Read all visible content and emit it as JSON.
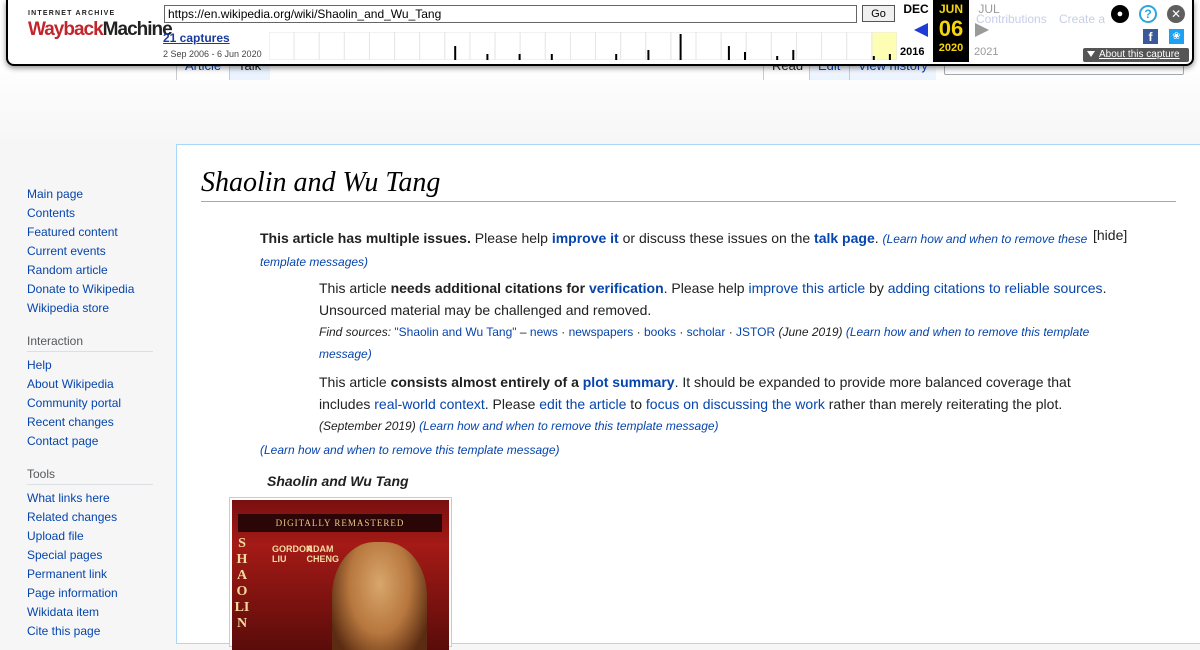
{
  "wayback": {
    "logo_top": "INTERNET ARCHIVE",
    "logo_wayback": "Wayback",
    "logo_machine": "Machine",
    "url": "https://en.wikipedia.org/wiki/Shaolin_and_Wu_Tang",
    "go_label": "Go",
    "captures": "21 captures",
    "range": "2 Sep 2006 - 6 Jun 2020",
    "prev_month": "DEC",
    "prev_year": "2016",
    "cur_month": "JUN",
    "cur_day": "06",
    "cur_year": "2020",
    "next_month": "JUL",
    "next_year": "2021",
    "about": "About this capture",
    "sparkline_heights": [
      0,
      0,
      0,
      0,
      0,
      0,
      0,
      0,
      0,
      0,
      0,
      14,
      0,
      6,
      0,
      6,
      0,
      6,
      0,
      0,
      0,
      6,
      0,
      10,
      0,
      26,
      0,
      0,
      14,
      8,
      0,
      4,
      10,
      0,
      0,
      0,
      0,
      4,
      6
    ]
  },
  "behind": {
    "contributions": "Contributions",
    "create_account": "Create a",
    "tab_article": "Article",
    "tab_talk": "Talk",
    "tab_read": "Read",
    "tab_edit": "Edit",
    "tab_history": "View history"
  },
  "sidebar": {
    "nav": [
      "Main page",
      "Contents",
      "Featured content",
      "Current events",
      "Random article",
      "Donate to Wikipedia",
      "Wikipedia store"
    ],
    "interaction_heading": "Interaction",
    "interaction": [
      "Help",
      "About Wikipedia",
      "Community portal",
      "Recent changes",
      "Contact page"
    ],
    "tools_heading": "Tools",
    "tools": [
      "What links here",
      "Related changes",
      "Upload file",
      "Special pages",
      "Permanent link",
      "Page information",
      "Wikidata item",
      "Cite this page"
    ]
  },
  "article": {
    "title": "Shaolin and Wu Tang",
    "issues": {
      "lead_bold": "This article has multiple issues.",
      "lead_1": " Please help ",
      "improve_it": "improve it",
      "lead_2": " or discuss these issues on the ",
      "talk_page": "talk page",
      "lead_3": ". ",
      "learn": "(Learn how and when to remove these template messages)",
      "hide": "[hide]"
    },
    "issue1": {
      "a": "This article ",
      "b_bold": "needs additional citations for ",
      "verification": "verification",
      "c": ". Please help ",
      "improve_article": "improve this article",
      "d": " by ",
      "adding": "adding citations to reliable sources",
      "e": ". Unsourced material may be challenged and removed.",
      "find_sources": "Find sources: ",
      "src_title": "\"Shaolin and Wu Tang\"",
      "dash": " – ",
      "src_news": "news",
      "src_newspapers": "newspapers",
      "src_books": "books",
      "src_scholar": "scholar",
      "src_jstor": "JSTOR",
      "date": " (June 2019) ",
      "learn": "(Learn how and when to remove this template message)"
    },
    "issue2": {
      "a": "This article ",
      "b_bold": "consists almost entirely of a ",
      "plot_summary": "plot summary",
      "c": ". It should be expanded to provide more balanced coverage that includes ",
      "real_world": "real-world context",
      "d": ". Please ",
      "edit_article": "edit the article",
      "e": " to ",
      "focus": "focus on discussing the work",
      "f": " rather than merely reiterating the plot.",
      "date": "(September 2019) ",
      "learn": "(Learn how and when to remove this template message)"
    },
    "footer_learn": "(Learn how and when to remove this template message)",
    "infobox_title": "Shaolin and Wu Tang",
    "cover": {
      "band": "DIGITALLY REMASTERED",
      "side": "SHAOLIN",
      "name1": "GORDON LIU",
      "name2": "ADAM CHENG"
    }
  }
}
